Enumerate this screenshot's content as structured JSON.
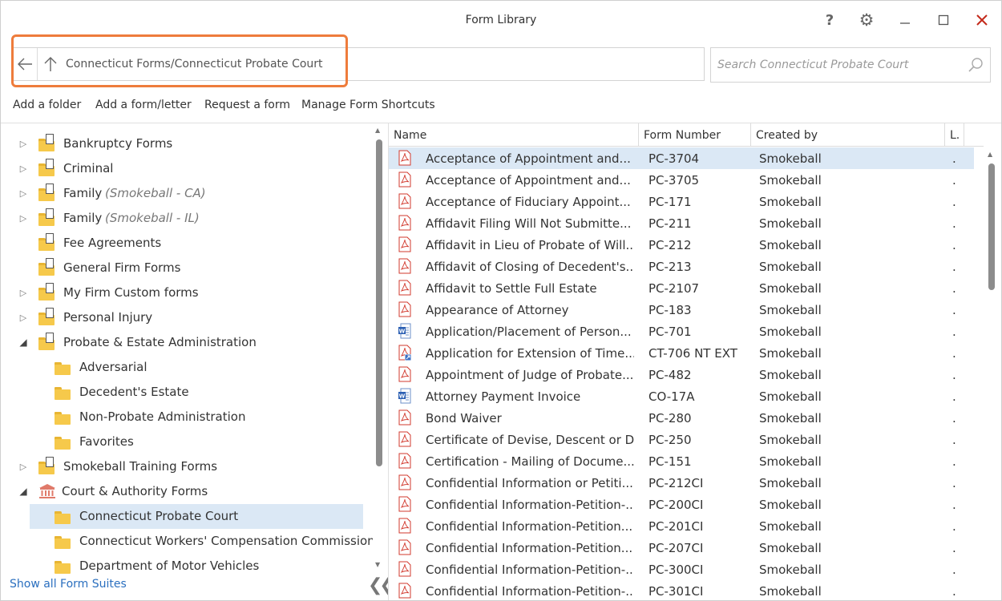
{
  "window": {
    "title": "Form Library"
  },
  "address": {
    "path": "Connecticut Forms/Connecticut Probate Court"
  },
  "search": {
    "placeholder": "Search Connecticut Probate Court"
  },
  "toolbar": {
    "add_folder": "Add a folder",
    "add_form": "Add a form/letter",
    "request_form": "Request a form",
    "manage_shortcuts": "Manage Form Shortcuts"
  },
  "tree": [
    {
      "label": "Bankruptcy Forms",
      "sub": "",
      "level": 0,
      "expander": "closed",
      "icon": "folder-doc"
    },
    {
      "label": "Criminal",
      "sub": "",
      "level": 0,
      "expander": "closed",
      "icon": "folder-doc"
    },
    {
      "label": "Family",
      "sub": "(Smokeball - CA)",
      "level": 0,
      "expander": "closed",
      "icon": "folder-doc"
    },
    {
      "label": "Family",
      "sub": "(Smokeball - IL)",
      "level": 0,
      "expander": "closed",
      "icon": "folder-doc"
    },
    {
      "label": "Fee Agreements",
      "sub": "",
      "level": 0,
      "expander": "none",
      "icon": "folder-doc"
    },
    {
      "label": "General Firm Forms",
      "sub": "",
      "level": 0,
      "expander": "none",
      "icon": "folder-doc"
    },
    {
      "label": "My Firm Custom forms",
      "sub": "",
      "level": 0,
      "expander": "closed",
      "icon": "folder-doc"
    },
    {
      "label": "Personal Injury",
      "sub": "",
      "level": 0,
      "expander": "closed",
      "icon": "folder-doc"
    },
    {
      "label": "Probate & Estate Administration",
      "sub": "",
      "level": 0,
      "expander": "open",
      "icon": "folder-doc"
    },
    {
      "label": "Adversarial",
      "sub": "",
      "level": 1,
      "expander": "none",
      "icon": "folder"
    },
    {
      "label": "Decedent's Estate",
      "sub": "",
      "level": 1,
      "expander": "none",
      "icon": "folder"
    },
    {
      "label": "Non-Probate Administration",
      "sub": "",
      "level": 1,
      "expander": "none",
      "icon": "folder"
    },
    {
      "label": "Favorites",
      "sub": "",
      "level": 1,
      "expander": "none",
      "icon": "folder"
    },
    {
      "label": "Smokeball Training Forms",
      "sub": "",
      "level": 0,
      "expander": "closed",
      "icon": "folder-doc"
    },
    {
      "label": "Court & Authority Forms",
      "sub": "",
      "level": 0,
      "expander": "open",
      "icon": "court"
    },
    {
      "label": "Connecticut Probate Court",
      "sub": "",
      "level": 1,
      "expander": "none",
      "icon": "folder",
      "selected": true
    },
    {
      "label": "Connecticut Workers' Compensation Commission",
      "sub": "",
      "level": 1,
      "expander": "none",
      "icon": "folder"
    },
    {
      "label": "Department of Motor Vehicles",
      "sub": "",
      "level": 1,
      "expander": "none",
      "icon": "folder"
    }
  ],
  "show_all": "Show all Form Suites",
  "columns": {
    "name": "Name",
    "number": "Form Number",
    "created_by": "Created by",
    "l": "L."
  },
  "forms": [
    {
      "name": "Acceptance of Appointment and...",
      "number": "PC-3704",
      "by": "Smokeball",
      "l": ".",
      "type": "pdf"
    },
    {
      "name": "Acceptance of Appointment and...",
      "number": "PC-3705",
      "by": "Smokeball",
      "l": ".",
      "type": "pdf"
    },
    {
      "name": "Acceptance of Fiduciary Appoint...",
      "number": "PC-171",
      "by": "Smokeball",
      "l": ".",
      "type": "pdf"
    },
    {
      "name": "Affidavit Filing Will Not Submitte...",
      "number": "PC-211",
      "by": "Smokeball",
      "l": ".",
      "type": "pdf"
    },
    {
      "name": "Affidavit in Lieu of Probate of Will...",
      "number": "PC-212",
      "by": "Smokeball",
      "l": ".",
      "type": "pdf"
    },
    {
      "name": "Affidavit of Closing of Decedent's...",
      "number": "PC-213",
      "by": "Smokeball",
      "l": ".",
      "type": "pdf"
    },
    {
      "name": "Affidavit to Settle Full Estate",
      "number": "PC-2107",
      "by": "Smokeball",
      "l": ".",
      "type": "pdf"
    },
    {
      "name": "Appearance of Attorney",
      "number": "PC-183",
      "by": "Smokeball",
      "l": ".",
      "type": "pdf"
    },
    {
      "name": "Application/Placement of Person...",
      "number": "PC-701",
      "by": "Smokeball",
      "l": ".",
      "type": "word"
    },
    {
      "name": "Application for Extension of Time...",
      "number": "CT-706 NT EXT",
      "by": "Smokeball",
      "l": ".",
      "type": "pdf-link"
    },
    {
      "name": "Appointment of Judge of Probate...",
      "number": "PC-482",
      "by": "Smokeball",
      "l": ".",
      "type": "pdf"
    },
    {
      "name": "Attorney Payment Invoice",
      "number": "CO-17A",
      "by": "Smokeball",
      "l": ".",
      "type": "word"
    },
    {
      "name": "Bond Waiver",
      "number": "PC-280",
      "by": "Smokeball",
      "l": ".",
      "type": "pdf"
    },
    {
      "name": "Certificate of Devise, Descent or D...",
      "number": "PC-250",
      "by": "Smokeball",
      "l": ".",
      "type": "pdf"
    },
    {
      "name": "Certification - Mailing of Docume...",
      "number": "PC-151",
      "by": "Smokeball",
      "l": ".",
      "type": "pdf"
    },
    {
      "name": "Confidential Information or Petiti...",
      "number": "PC-212CI",
      "by": "Smokeball",
      "l": ".",
      "type": "pdf"
    },
    {
      "name": "Confidential Information-Petition-...",
      "number": "PC-200CI",
      "by": "Smokeball",
      "l": ".",
      "type": "pdf"
    },
    {
      "name": "Confidential Information-Petition...",
      "number": "PC-201CI",
      "by": "Smokeball",
      "l": ".",
      "type": "pdf"
    },
    {
      "name": "Confidential Information-Petition...",
      "number": "PC-207CI",
      "by": "Smokeball",
      "l": ".",
      "type": "pdf"
    },
    {
      "name": "Confidential Information-Petition-...",
      "number": "PC-300CI",
      "by": "Smokeball",
      "l": ".",
      "type": "pdf"
    },
    {
      "name": "Confidential Information-Petition-...",
      "number": "PC-301CI",
      "by": "Smokeball",
      "l": ".",
      "type": "pdf"
    }
  ],
  "colors": {
    "accent_ring": "#ee7c3c",
    "selection": "#dbe8f5",
    "link": "#2a6fbf",
    "close": "#c42b1c"
  }
}
